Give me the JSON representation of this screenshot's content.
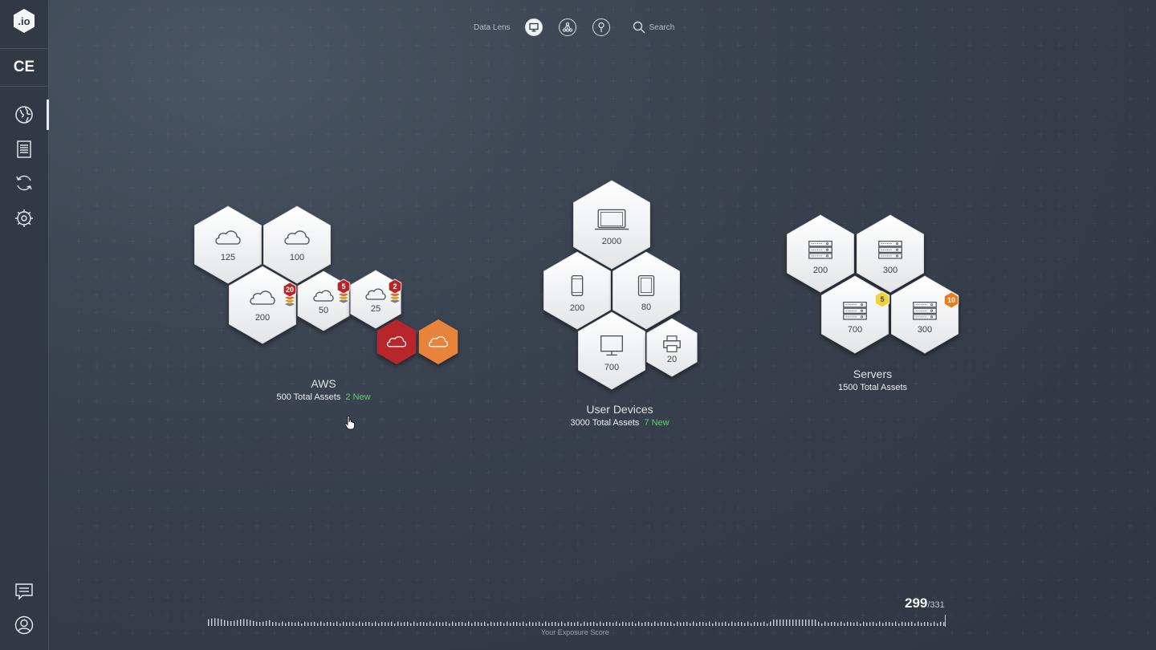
{
  "sidebar": {
    "logo_text": ".io",
    "ce_label": "CE",
    "items": [
      {
        "name": "globe-icon",
        "active": true
      },
      {
        "name": "report-icon",
        "active": false
      },
      {
        "name": "refresh-icon",
        "active": false
      },
      {
        "name": "settings-icon",
        "active": false
      }
    ],
    "bottom": [
      {
        "name": "chat-icon"
      },
      {
        "name": "user-icon"
      }
    ]
  },
  "topbar": {
    "lens_label": "Data Lens",
    "buttons": [
      {
        "name": "monitor-icon",
        "active": true
      },
      {
        "name": "network-icon",
        "active": false
      },
      {
        "name": "location-pin-icon",
        "active": false
      }
    ],
    "search_label": "Search"
  },
  "groups": {
    "aws": {
      "title": "AWS",
      "total": "500 Total Assets",
      "new": "2 New",
      "tiles": [
        {
          "icon": "cloud-icon",
          "count": "125"
        },
        {
          "icon": "cloud-icon",
          "count": "100"
        },
        {
          "icon": "cloud-icon",
          "count": "200",
          "badge": "20"
        },
        {
          "icon": "cloud-icon",
          "count": "50",
          "badge": "5"
        },
        {
          "icon": "cloud-icon",
          "count": "25",
          "badge": "2"
        },
        {
          "icon": "cloud-icon",
          "count": "",
          "color": "#b7262a"
        },
        {
          "icon": "cloud-icon",
          "count": "",
          "color": "#e8833b"
        }
      ]
    },
    "user_devices": {
      "title": "User Devices",
      "total": "3000 Total Assets",
      "new": "7 New",
      "tiles": [
        {
          "icon": "laptop-icon",
          "count": "2000"
        },
        {
          "icon": "phone-icon",
          "count": "200"
        },
        {
          "icon": "tablet-icon",
          "count": "80"
        },
        {
          "icon": "desktop-icon",
          "count": "700"
        },
        {
          "icon": "printer-icon",
          "count": "20"
        }
      ]
    },
    "servers": {
      "title": "Servers",
      "total": "1500 Total Assets",
      "tiles": [
        {
          "icon": "server-icon",
          "count": "200"
        },
        {
          "icon": "server-icon",
          "count": "300"
        },
        {
          "icon": "server-icon",
          "count": "700",
          "badge": "5",
          "badge_color": "#f2d23c"
        },
        {
          "icon": "server-icon",
          "count": "300",
          "badge": "10",
          "badge_color": "#ee7a1e"
        }
      ]
    }
  },
  "exposure": {
    "score": "299",
    "max": "/331",
    "label": "Your Exposure Score"
  },
  "colors": {
    "new_green": "#5fcf6b",
    "critical_red": "#b7262a",
    "high_orange": "#e8833b"
  }
}
